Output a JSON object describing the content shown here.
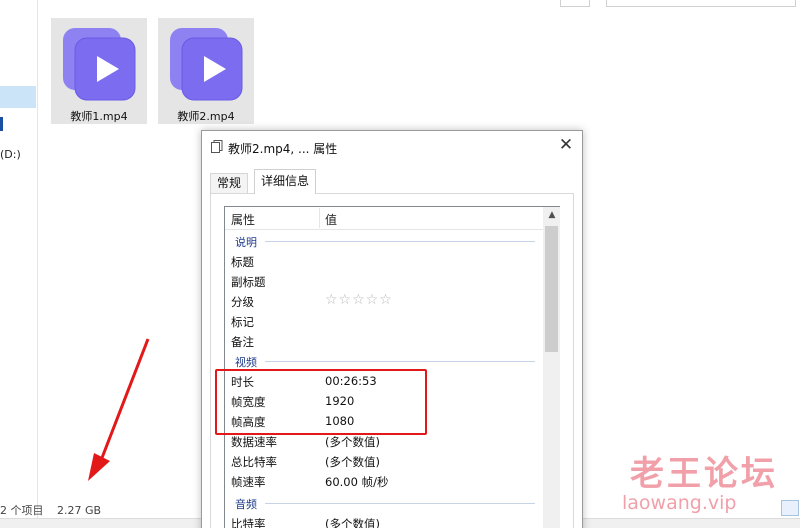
{
  "explorer": {
    "drive_label": "(D:)",
    "files": [
      {
        "name": "教师1.mp4",
        "icon": "video-file-icon"
      },
      {
        "name": "教师2.mp4",
        "icon": "video-file-icon"
      }
    ],
    "status": {
      "item_count": "2 个项目",
      "selection_size": "2.27 GB"
    }
  },
  "dialog": {
    "title": "教师2.mp4, ... 属性",
    "close_glyph": "✕",
    "tabs": [
      {
        "label": "常规",
        "active": false
      },
      {
        "label": "详细信息",
        "active": true
      }
    ],
    "columns": {
      "property": "属性",
      "value": "值"
    },
    "groups": {
      "description": "说明",
      "video": "视频",
      "audio": "音频"
    },
    "description_props": [
      {
        "name": "标题",
        "value": ""
      },
      {
        "name": "副标题",
        "value": ""
      },
      {
        "name": "分级",
        "value": "☆☆☆☆☆"
      },
      {
        "name": "标记",
        "value": ""
      },
      {
        "name": "备注",
        "value": ""
      }
    ],
    "video_props": [
      {
        "name": "时长",
        "value": "00:26:53"
      },
      {
        "name": "帧宽度",
        "value": "1920"
      },
      {
        "name": "帧高度",
        "value": "1080"
      },
      {
        "name": "数据速率",
        "value": "(多个数值)"
      },
      {
        "name": "总比特率",
        "value": "(多个数值)"
      },
      {
        "name": "帧速率",
        "value": "60.00 帧/秒"
      }
    ],
    "audio_props": [
      {
        "name": "比特率",
        "value": "(多个数值)"
      }
    ]
  },
  "watermark": {
    "main": "老王论坛",
    "sub": "laowang.vip"
  },
  "colors": {
    "highlight": "#e31818",
    "arrow": "#e31818",
    "group_text": "#1e3a8a",
    "file_icon": "#7b6cf0",
    "watermark": "#ec808c"
  }
}
